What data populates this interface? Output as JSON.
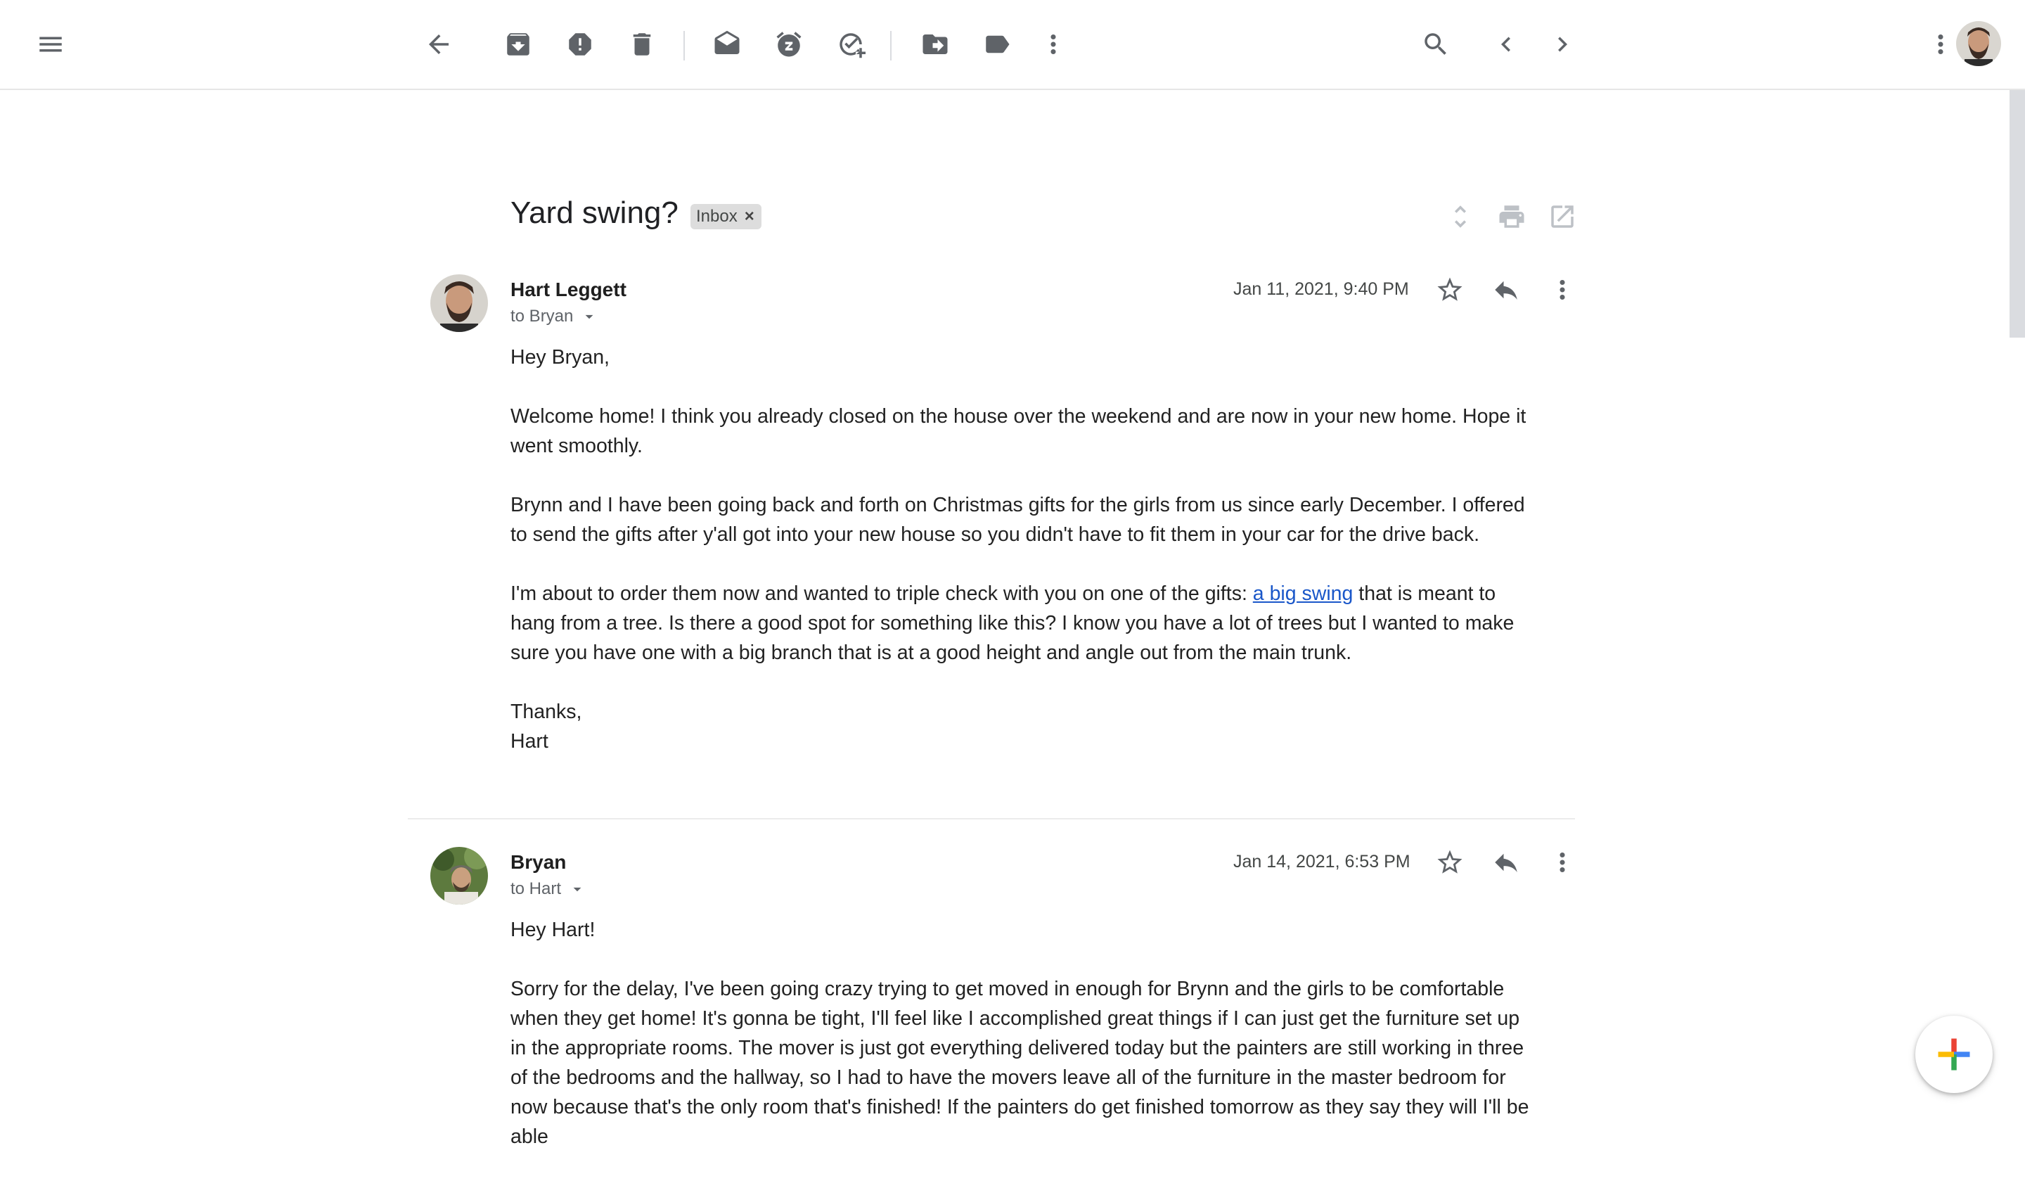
{
  "toolbar": {
    "icons": [
      "menu-icon",
      "back-icon",
      "archive-icon",
      "report-spam-icon",
      "delete-icon",
      "mark-unread-icon",
      "snooze-icon",
      "add-task-icon",
      "move-to-icon",
      "labels-icon",
      "more-icon",
      "search-icon",
      "newer-icon",
      "older-icon",
      "apps-more-icon"
    ]
  },
  "thread": {
    "subject": "Yard swing?",
    "label": "Inbox",
    "label_remove": "×"
  },
  "messages": [
    {
      "sender": "Hart Leggett",
      "recipient": "to Bryan",
      "date": "Jan 11, 2021, 9:40 PM",
      "greeting": "Hey Bryan,",
      "p1": "Welcome home! I think you already closed on the house over the weekend and are now in your new home. Hope it went smoothly.",
      "p2": "Brynn and I have been going back and forth on Christmas gifts for the girls from us since early December. I offered to send the gifts after y'all got into your new house so you didn't have to fit them in your car for the drive back.",
      "p3_before": "I'm about to order them now and wanted to triple check with you on one of the gifts: ",
      "p3_link": "a big swing",
      "p3_after": " that is meant to hang from a tree. Is there a good spot for something like this? I know you have a lot of trees but I wanted to make sure you have one with a big branch that is at a good height and angle out from the main trunk.",
      "signoff": "Thanks,",
      "signature": "Hart"
    },
    {
      "sender": "Bryan",
      "recipient": "to Hart",
      "date": "Jan 14, 2021, 6:53 PM",
      "greeting": "Hey Hart!",
      "p1": "Sorry for the delay, I've been going crazy trying to get moved in enough for Brynn and the girls to be comfortable when they get home! It's gonna be tight, I'll feel like I accomplished great things if I can just get the furniture set up in the appropriate rooms. The mover is just got everything delivered today but the painters are still working in three of the bedrooms and the hallway, so I had to have the movers leave all of the furniture in the master bedroom for now because that's the only room that's finished! If the painters do get finished tomorrow as they say they will I'll be able"
    }
  ],
  "colors": {
    "icon": "#5f6368",
    "link": "#1a57c9",
    "fab_red": "#ea4335",
    "fab_blue": "#4285f4",
    "fab_green": "#34a853",
    "fab_yellow": "#fbbc04"
  }
}
